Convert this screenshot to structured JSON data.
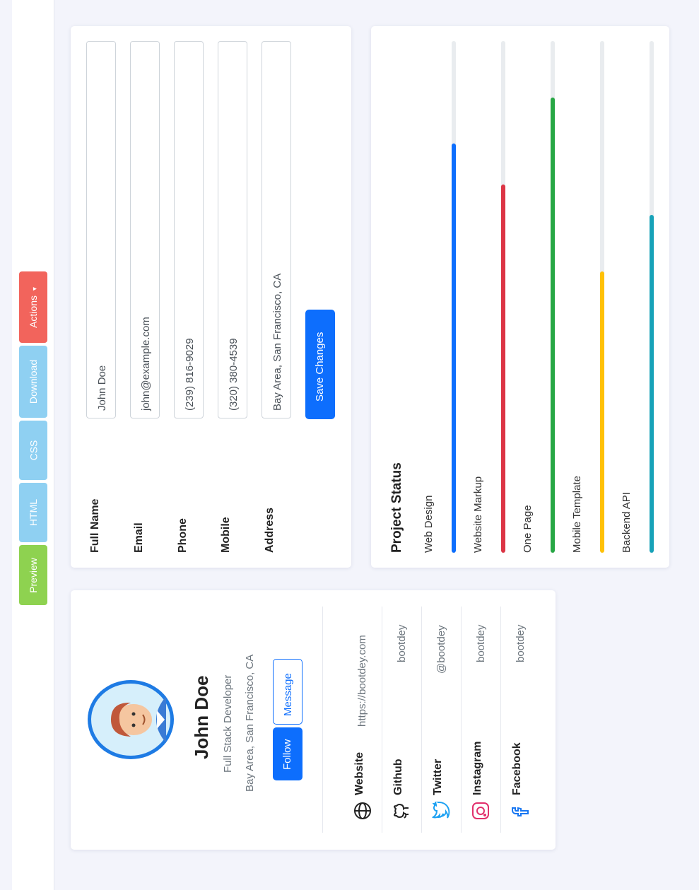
{
  "toolbar": {
    "buttons": [
      {
        "label": "Preview",
        "color": "#8ed250"
      },
      {
        "label": "HTML",
        "color": "#8fd0f2"
      },
      {
        "label": "CSS",
        "color": "#8fd0f2"
      },
      {
        "label": "Download",
        "color": "#8fd0f2"
      },
      {
        "label": "Actions",
        "color": "#f2645c"
      }
    ],
    "actions_caret": "▾"
  },
  "form": {
    "fields": [
      {
        "label": "Full Name",
        "value": "John Doe"
      },
      {
        "label": "Email",
        "value": "john@example.com"
      },
      {
        "label": "Phone",
        "value": "(239) 816-9029"
      },
      {
        "label": "Mobile",
        "value": "(320) 380-4539"
      },
      {
        "label": "Address",
        "value": "Bay Area, San Francisco, CA"
      }
    ],
    "save_label": "Save Changes"
  },
  "project_status": {
    "title": "Project Status",
    "items": [
      {
        "label": "Web Design",
        "percent": 80,
        "color": "#0d6efd"
      },
      {
        "label": "Website Markup",
        "percent": 72,
        "color": "#dc3545"
      },
      {
        "label": "One Page",
        "percent": 89,
        "color": "#28a745"
      },
      {
        "label": "Mobile Template",
        "percent": 55,
        "color": "#ffc107"
      },
      {
        "label": "Backend API",
        "percent": 66,
        "color": "#17a2b8"
      }
    ]
  },
  "profile": {
    "name": "John Doe",
    "title": "Full Stack Developer",
    "location": "Bay Area, San Francisco, CA",
    "follow_label": "Follow",
    "message_label": "Message",
    "links": [
      {
        "icon": "globe-icon",
        "name": "Website",
        "value": "https://bootdey.com",
        "color": "#222222"
      },
      {
        "icon": "github-icon",
        "name": "Github",
        "value": "bootdey",
        "color": "#222222"
      },
      {
        "icon": "twitter-icon",
        "name": "Twitter",
        "value": "@bootdey",
        "color": "#1da1f2"
      },
      {
        "icon": "instagram-icon",
        "name": "Instagram",
        "value": "bootdey",
        "color": "#e1306c"
      },
      {
        "icon": "facebook-icon",
        "name": "Facebook",
        "value": "bootdey",
        "color": "#1877f2"
      }
    ]
  },
  "colors": {
    "primary": "#0d6efd",
    "background": "#f3f4fb"
  }
}
